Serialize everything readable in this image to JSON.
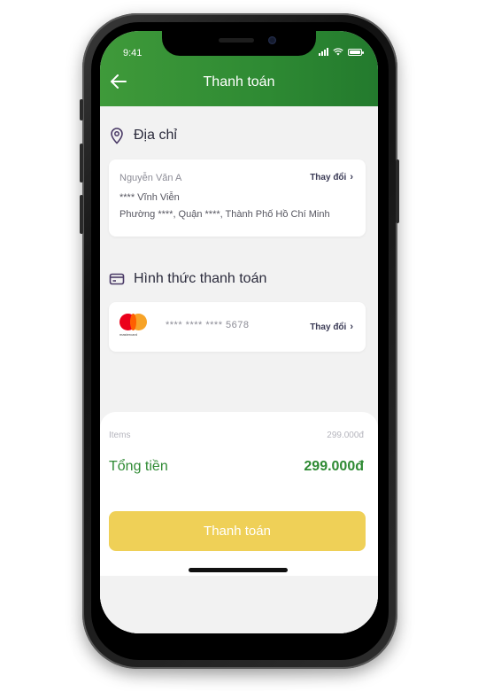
{
  "status_bar": {
    "time": "9:41"
  },
  "header": {
    "title": "Thanh toán"
  },
  "address": {
    "section_label": "Địa chỉ",
    "name": "Nguyễn Văn A",
    "line1": "**** Vĩnh Viễn",
    "line2": "Phường ****, Quận ****, Thành Phố Hồ Chí Minh",
    "change_label": "Thay đổi"
  },
  "payment": {
    "section_label": "Hình thức thanh toán",
    "card_brand": "mastercard",
    "card_number": "**** **** **** 5678",
    "change_label": "Thay đổi"
  },
  "summary": {
    "items_label": "Items",
    "items_value": "299.000đ",
    "total_label": "Tổng tiền",
    "total_value": "299.000đ"
  },
  "actions": {
    "pay_button_label": "Thanh toán"
  },
  "colors": {
    "brand_green": "#2e8a33",
    "button_yellow": "#efd057",
    "background": "#f2f2f2"
  }
}
